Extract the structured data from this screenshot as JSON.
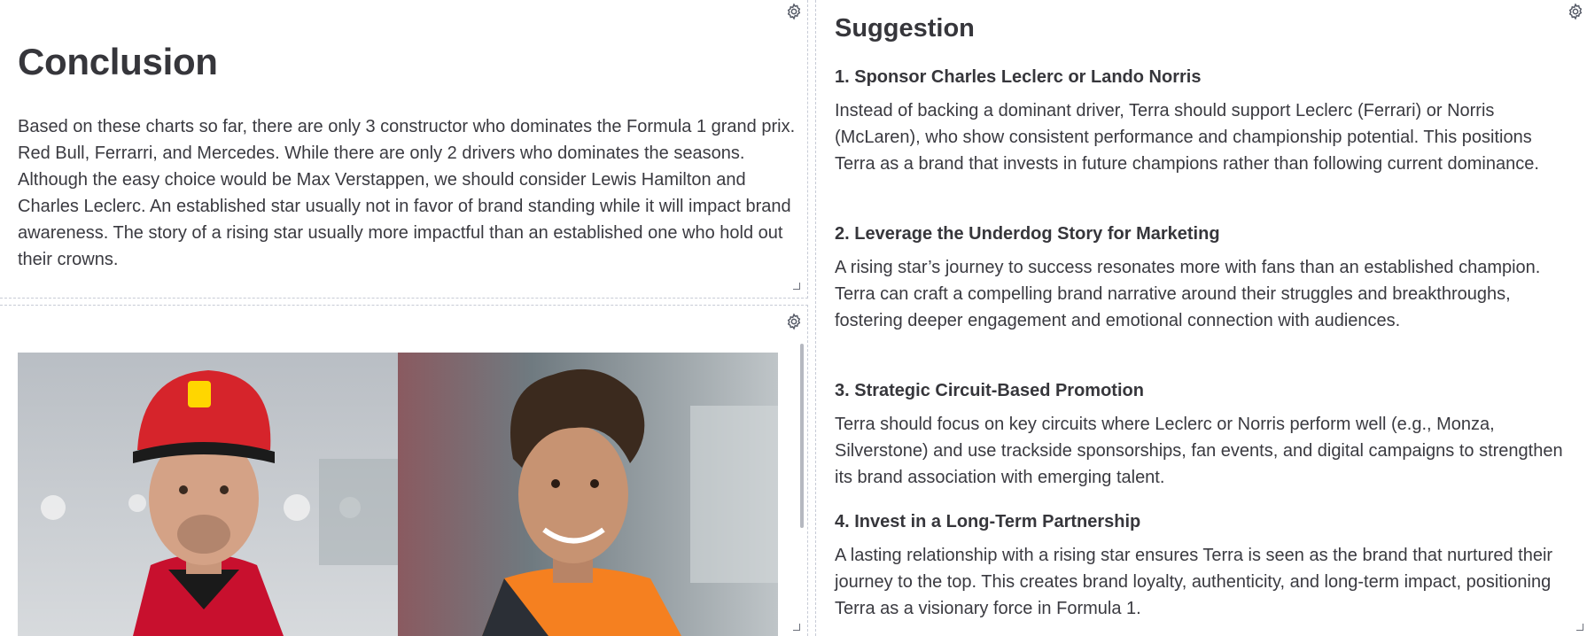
{
  "conclusion": {
    "title": "Conclusion",
    "text": "Based on these charts so far, there are only 3 constructor who dominates the Formula 1 grand prix. Red Bull, Ferrarri, and Mercedes. While there are only 2 drivers who dominates the seasons. Although the easy choice would be Max Verstappen, we should consider Lewis Hamilton and Charles Leclerc. An established star usually not in favor of brand standing while it will impact brand awareness. The story of a rising star usually more impactful than an established one who hold out their crowns."
  },
  "image_tile": {
    "photos": [
      {
        "name": "charles-leclerc-photo",
        "colors": {
          "bg": "#c9cdd2",
          "cap": "#d6242b",
          "shirt": "#c8102e"
        }
      },
      {
        "name": "lando-norris-photo",
        "colors": {
          "bg": "#6f7a80",
          "hair": "#3b2a1e",
          "shirt": "#f58020"
        }
      }
    ]
  },
  "suggestion": {
    "title": "Suggestion",
    "items": [
      {
        "heading": "1. Sponsor Charles Leclerc or Lando Norris",
        "body": "Instead of backing a dominant driver, Terra should support Leclerc (Ferrari) or Norris (McLaren), who show consistent performance and championship potential. This positions Terra as a brand that invests in future champions rather than following current dominance."
      },
      {
        "heading": "2. Leverage the Underdog Story for Marketing",
        "body": "A rising star’s journey to success resonates more with fans than an established champion. Terra can craft a compelling brand narrative around their struggles and breakthroughs, fostering deeper engagement and emotional connection with audiences."
      },
      {
        "heading": "3. Strategic Circuit-Based Promotion",
        "body": "Terra should focus on key circuits where Leclerc or Norris perform well (e.g., Monza, Silverstone) and use trackside sponsorships, fan events, and digital campaigns to strengthen its brand association with emerging talent."
      },
      {
        "heading": "4. Invest in a Long-Term Partnership",
        "body": "A lasting relationship with a rising star ensures Terra is seen as the brand that nurtured their journey to the top. This creates brand loyalty, authenticity, and long-term impact, positioning Terra as a visionary force in Formula 1."
      }
    ]
  },
  "icons": {
    "settings": "gear-icon",
    "resize": "resize-handle-icon"
  }
}
